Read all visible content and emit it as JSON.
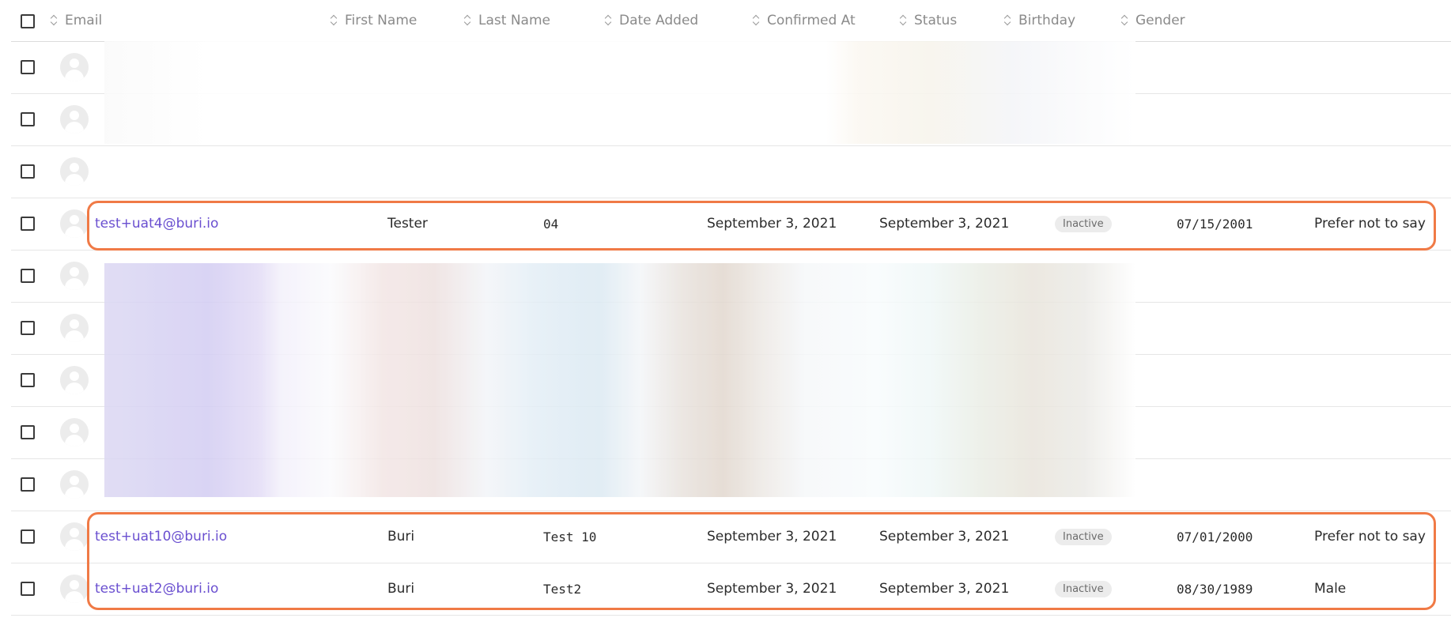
{
  "headers": {
    "email": "Email",
    "first_name": "First Name",
    "last_name": "Last Name",
    "date_added": "Date Added",
    "confirmed_at": "Confirmed At",
    "status": "Status",
    "birthday": "Birthday",
    "gender": "Gender"
  },
  "rows": [
    {
      "email": "",
      "first_name": "",
      "last_name": "",
      "date_added": "",
      "confirmed_at": "",
      "status": "",
      "birthday": "",
      "gender": ""
    },
    {
      "email": "",
      "first_name": "",
      "last_name": "",
      "date_added": "",
      "confirmed_at": "",
      "status": "",
      "birthday": "",
      "gender": ""
    },
    {
      "email": "",
      "first_name": "",
      "last_name": "",
      "date_added": "",
      "confirmed_at": "",
      "status": "",
      "birthday": "",
      "gender": ""
    },
    {
      "email": "test+uat4@buri.io",
      "first_name": "Tester",
      "last_name": "04",
      "date_added": "September 3, 2021",
      "confirmed_at": "September 3, 2021",
      "status": "Inactive",
      "birthday": "07/15/2001",
      "gender": "Prefer not to say"
    },
    {
      "email": "",
      "first_name": "",
      "last_name": "",
      "date_added": "",
      "confirmed_at": "",
      "status": "",
      "birthday": "",
      "gender": ""
    },
    {
      "email": "",
      "first_name": "",
      "last_name": "",
      "date_added": "",
      "confirmed_at": "",
      "status": "",
      "birthday": "",
      "gender": ""
    },
    {
      "email": "",
      "first_name": "",
      "last_name": "",
      "date_added": "",
      "confirmed_at": "",
      "status": "",
      "birthday": "",
      "gender": ""
    },
    {
      "email": "",
      "first_name": "",
      "last_name": "",
      "date_added": "",
      "confirmed_at": "",
      "status": "",
      "birthday": "",
      "gender": ""
    },
    {
      "email": "",
      "first_name": "",
      "last_name": "",
      "date_added": "",
      "confirmed_at": "",
      "status": "",
      "birthday": "",
      "gender": ""
    },
    {
      "email": "test+uat10@buri.io",
      "first_name": "Buri",
      "last_name": "Test 10",
      "date_added": "September 3, 2021",
      "confirmed_at": "September 3, 2021",
      "status": "Inactive",
      "birthday": "07/01/2000",
      "gender": "Prefer not to say"
    },
    {
      "email": "test+uat2@buri.io",
      "first_name": "Buri",
      "last_name": "Test2",
      "date_added": "September 3, 2021",
      "confirmed_at": "September 3, 2021",
      "status": "Inactive",
      "birthday": "08/30/1989",
      "gender": "Male"
    }
  ],
  "colors": {
    "email_link": "#6a4fd0",
    "highlight": "#f07a46",
    "badge_bg": "#ececec"
  }
}
